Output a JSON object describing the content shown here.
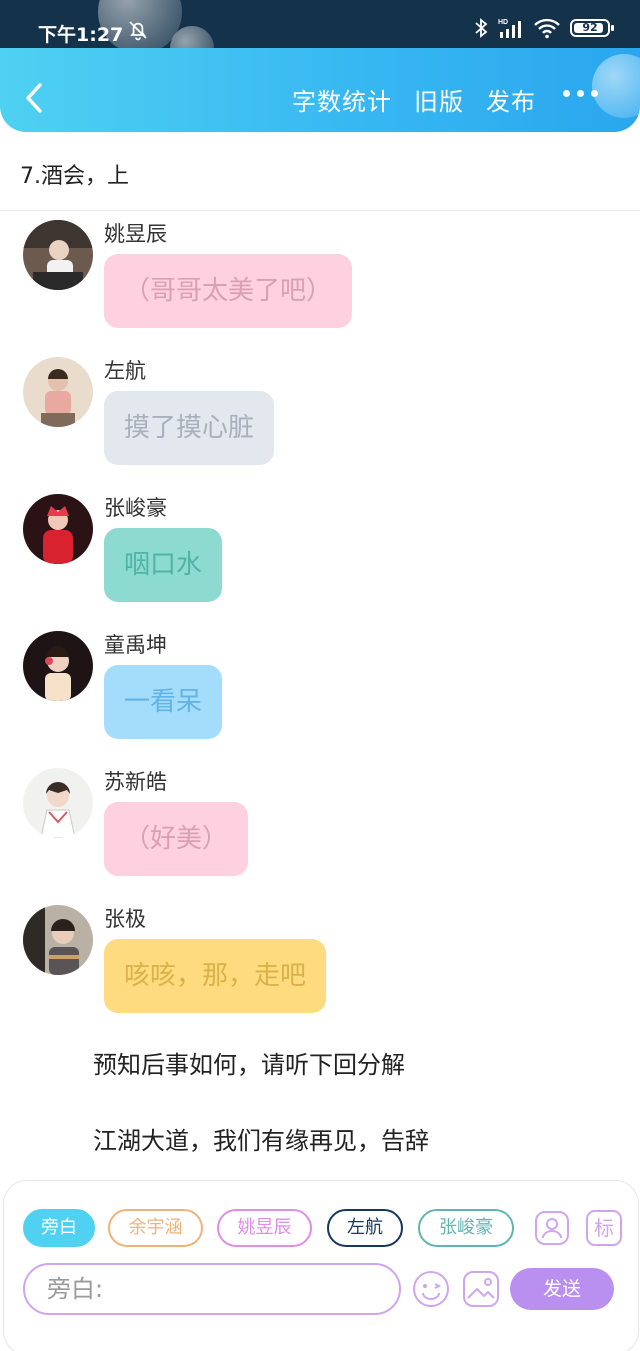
{
  "status_bar": {
    "time": "下午1:27",
    "battery": "92",
    "battery_level": 0.92,
    "icons": [
      "bell-off-icon",
      "bluetooth-icon",
      "signal-icon",
      "wifi-icon",
      "battery-icon"
    ]
  },
  "header": {
    "back_icon": "chevron-left-icon",
    "actions": [
      "字数统计",
      "旧版",
      "发布"
    ],
    "more_icon": "more-dots-icon"
  },
  "chapter": {
    "title": "7.酒会，上"
  },
  "messages": [
    {
      "speaker": "姚昱辰",
      "text": "（哥哥太美了吧）",
      "bubble_color": "#ffd0df",
      "text_color": "#d9a0b4"
    },
    {
      "speaker": "左航",
      "text": "摸了摸心脏",
      "bubble_color": "#e3e7ee",
      "text_color": "#a9b0bc"
    },
    {
      "speaker": "张峻豪",
      "text": "咽口水",
      "bubble_color": "#8ddbd0",
      "text_color": "#4fb3a6"
    },
    {
      "speaker": "童禹坤",
      "text": "一看呆",
      "bubble_color": "#a3ddfb",
      "text_color": "#62b4e6"
    },
    {
      "speaker": "苏新皓",
      "text": "（好美）",
      "bubble_color": "#ffd0df",
      "text_color": "#d9a0b4"
    },
    {
      "speaker": "张极",
      "text": "咳咳，那，走吧",
      "bubble_color": "#fedb7e",
      "text_color": "#dbb14a"
    }
  ],
  "narration": [
    "预知后事如何，请听下回分解",
    "江湖大道，我们有缘再见，告辞"
  ],
  "composer": {
    "chips": [
      {
        "label": "旁白",
        "color": "#4fd1f2",
        "active": true
      },
      {
        "label": "余宇涵",
        "color": "#f0b27a",
        "active": false
      },
      {
        "label": "姚昱辰",
        "color": "#e08de8",
        "active": false
      },
      {
        "label": "左航",
        "color": "#17375e",
        "active": false
      },
      {
        "label": "张峻豪",
        "color": "#5fb6b0",
        "active": false
      }
    ],
    "role_icon": "user-role-icon",
    "tag_icon_label": "标",
    "input_placeholder": "旁白:",
    "emoji_icon": "emoji-icon",
    "image_icon": "image-icon",
    "send_label": "发送"
  }
}
